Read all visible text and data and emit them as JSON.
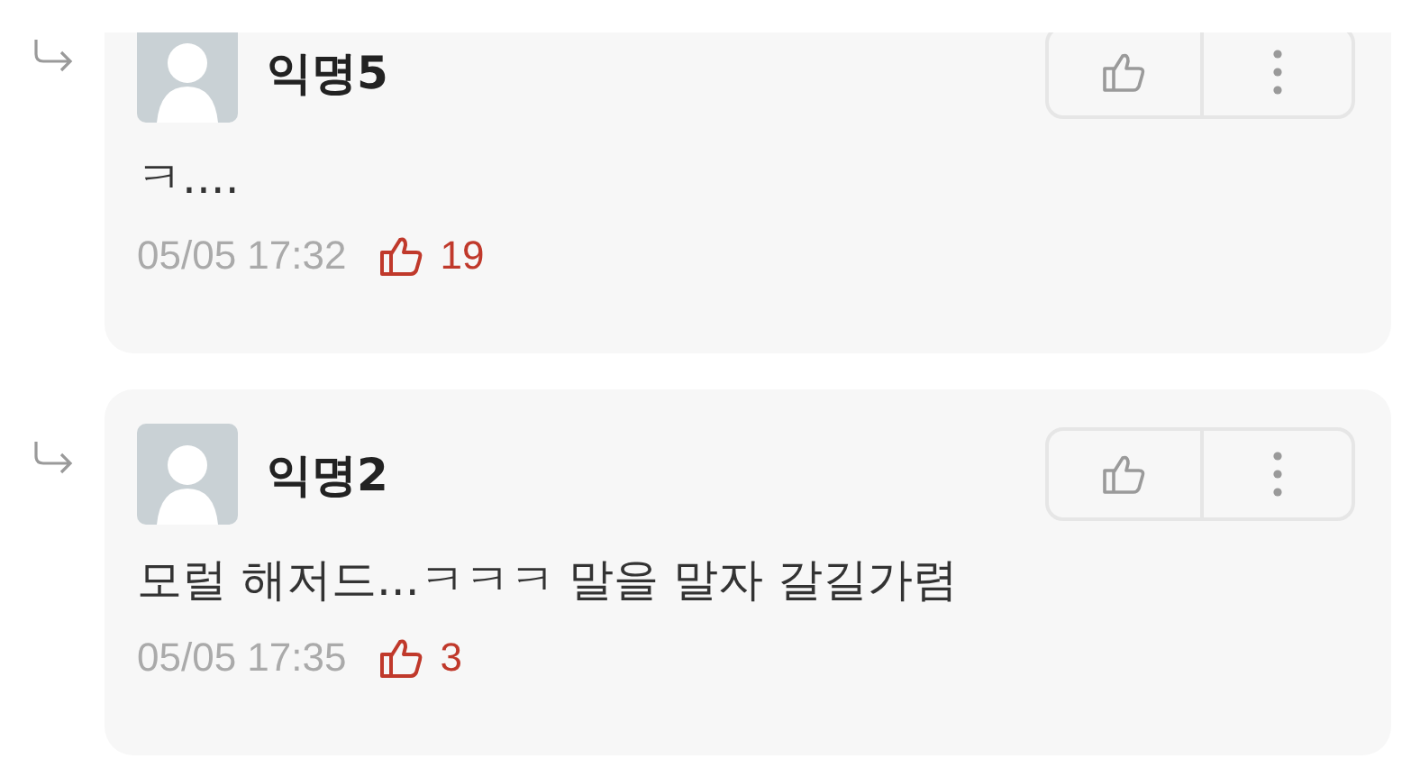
{
  "comments": [
    {
      "author": "익명5",
      "text": "ㅋ....",
      "time": "05/05 17:32",
      "likes": "19"
    },
    {
      "author": "익명2",
      "text": "모럴 해저드...ㅋㅋㅋ 말을 말자 갈길가렴",
      "time": "05/05 17:35",
      "likes": "3"
    }
  ]
}
